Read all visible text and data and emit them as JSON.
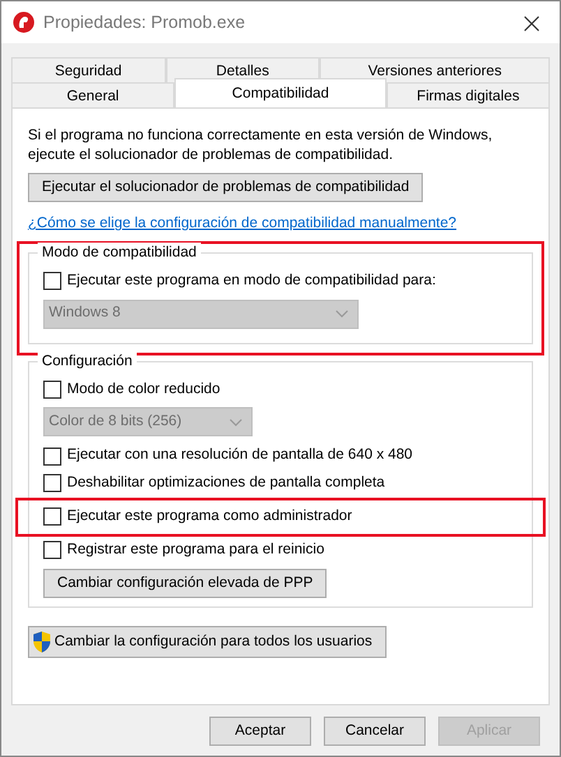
{
  "window": {
    "title": "Propiedades: Promob.exe"
  },
  "tab_rows": [
    {
      "tabs": [
        {
          "label": "Seguridad",
          "selected": false
        },
        {
          "label": "Detalles",
          "selected": false
        },
        {
          "label": "Versiones anteriores",
          "selected": false
        }
      ]
    },
    {
      "tabs": [
        {
          "label": "General",
          "selected": false
        },
        {
          "label": "Compatibilidad",
          "selected": true
        },
        {
          "label": "Firmas digitales",
          "selected": false
        }
      ]
    }
  ],
  "intro": "Si el programa no funciona correctamente en esta versión de Windows, ejecute el solucionador de problemas de compatibilidad.",
  "troubleshooter_button": "Ejecutar el solucionador de problemas de compatibilidad",
  "help_link": "¿Cómo se elige la configuración de compatibilidad manualmente?",
  "groups": [
    {
      "title": "Modo de compatibilidad",
      "highlighted": true,
      "items": [
        {
          "kind": "checkbox",
          "label": "Ejecutar este programa en modo de compatibilidad para:",
          "checked": false,
          "highlighted": false
        },
        {
          "kind": "dropdown",
          "value": "Windows 8",
          "disabled": true
        }
      ]
    },
    {
      "title": "Configuración",
      "highlighted": false,
      "items": [
        {
          "kind": "checkbox",
          "label": "Modo de color reducido",
          "checked": false,
          "highlighted": false
        },
        {
          "kind": "dropdown",
          "value": "Color de 8 bits (256)",
          "disabled": true
        },
        {
          "kind": "checkbox",
          "label": "Ejecutar con una resolución de pantalla de 640 x 480",
          "checked": false,
          "highlighted": false
        },
        {
          "kind": "checkbox",
          "label": "Deshabilitar optimizaciones de pantalla completa",
          "checked": false,
          "highlighted": false
        },
        {
          "kind": "checkbox",
          "label": "Ejecutar este programa como administrador",
          "checked": false,
          "highlighted": true
        },
        {
          "kind": "checkbox",
          "label": "Registrar este programa para el reinicio",
          "checked": false,
          "highlighted": false
        },
        {
          "kind": "button",
          "label": "Cambiar configuración elevada de PPP"
        }
      ]
    }
  ],
  "all_users_button": "Cambiar la configuración para todos los usuarios",
  "buttons": [
    {
      "label": "Aceptar",
      "disabled": false
    },
    {
      "label": "Cancelar",
      "disabled": false
    },
    {
      "label": "Aplicar",
      "disabled": true
    }
  ]
}
